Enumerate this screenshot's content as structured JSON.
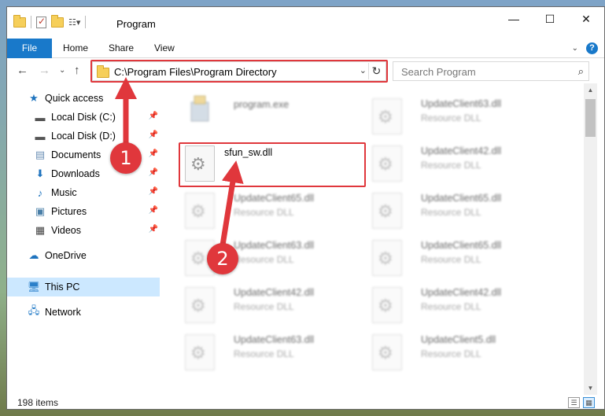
{
  "window": {
    "title": "Program",
    "controls": [
      "—",
      "☐",
      "✕"
    ]
  },
  "ribbon": {
    "tabs": [
      "File",
      "Home",
      "Share",
      "View"
    ]
  },
  "nav": {
    "address": "C:\\Program Files\\Program Directory",
    "search_placeholder": "Search Program"
  },
  "sidebar": {
    "items": [
      {
        "label": "Quick access",
        "icon": "star-icon",
        "pinned": false
      },
      {
        "label": "Local Disk (C:)",
        "icon": "drive-icon",
        "pinned": true
      },
      {
        "label": "Local Disk (D:)",
        "icon": "drive-icon",
        "pinned": true
      },
      {
        "label": "Documents",
        "icon": "documents-icon",
        "pinned": true
      },
      {
        "label": "Downloads",
        "icon": "download-icon",
        "pinned": true
      },
      {
        "label": "Music",
        "icon": "music-icon",
        "pinned": true
      },
      {
        "label": "Pictures",
        "icon": "pictures-icon",
        "pinned": true
      },
      {
        "label": "Videos",
        "icon": "videos-icon",
        "pinned": true
      },
      {
        "label": "OneDrive",
        "icon": "cloud-icon",
        "pinned": false
      },
      {
        "label": "This PC",
        "icon": "computer-icon",
        "pinned": false,
        "selected": true
      },
      {
        "label": "Network",
        "icon": "network-icon",
        "pinned": false
      }
    ]
  },
  "files": {
    "left": [
      {
        "name": "program.exe",
        "type": ""
      },
      {
        "name": "sfun_sw.dll",
        "type": "",
        "highlighted": true
      },
      {
        "name": "UpdateClient65.dll",
        "type": "Resource DLL"
      },
      {
        "name": "UpdateClient63.dll",
        "type": "Resource DLL"
      },
      {
        "name": "UpdateClient42.dll",
        "type": "Resource DLL"
      },
      {
        "name": "UpdateClient63.dll",
        "type": "Resource DLL"
      }
    ],
    "right": [
      {
        "name": "UpdateClient63.dll",
        "type": "Resource DLL"
      },
      {
        "name": "UpdateClient42.dll",
        "type": "Resource DLL"
      },
      {
        "name": "UpdateClient65.dll",
        "type": "Resource DLL"
      },
      {
        "name": "UpdateClient65.dll",
        "type": "Resource DLL"
      },
      {
        "name": "UpdateClient42.dll",
        "type": "Resource DLL"
      },
      {
        "name": "UpdateClient5.dll",
        "type": "Resource DLL"
      }
    ]
  },
  "status": {
    "item_count": "198 items"
  },
  "annotations": {
    "badge1": "1",
    "badge2": "2",
    "color": "#e0373c"
  }
}
